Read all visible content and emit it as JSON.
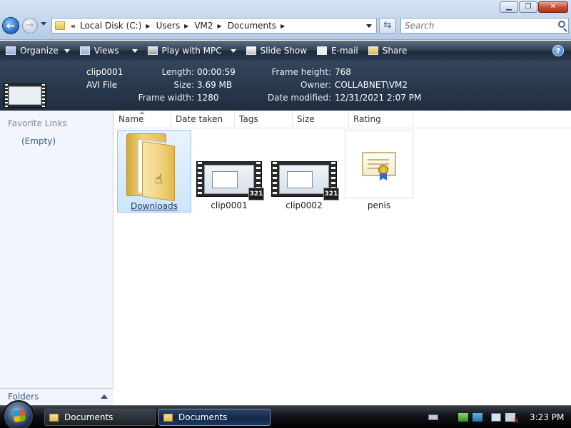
{
  "window": {
    "minimize_glyph": "▁",
    "maximize_glyph": "❐",
    "close_glyph": "✕"
  },
  "address": {
    "crumbs": [
      "Local Disk (C:)",
      "Users",
      "VM2",
      "Documents"
    ],
    "overflow_glyph": "«"
  },
  "search": {
    "placeholder": "Search"
  },
  "toolbar": {
    "organize": "Organize",
    "views": "Views",
    "play": "Play with MPC",
    "slideshow": "Slide Show",
    "email": "E-mail",
    "share": "Share",
    "help": "?"
  },
  "details": {
    "name": "clip0001",
    "type": "AVI File",
    "length_label": "Length:",
    "length": "00:00:59",
    "size_label": "Size:",
    "size": "3.69 MB",
    "fwidth_label": "Frame width:",
    "fwidth": "1280",
    "fheight_label": "Frame height:",
    "fheight": "768",
    "owner_label": "Owner:",
    "owner": "COLLABNET\\VM2",
    "modified_label": "Date modified:",
    "modified": "12/31/2021 2:07 PM"
  },
  "navpane": {
    "favorite_links": "Favorite Links",
    "empty": "(Empty)",
    "folders": "Folders"
  },
  "columns": [
    "Name",
    "Date taken",
    "Tags",
    "Size",
    "Rating"
  ],
  "items": [
    {
      "label": "Downloads",
      "kind": "folder",
      "selected": true
    },
    {
      "label": "clip0001",
      "kind": "video",
      "badge": "321"
    },
    {
      "label": "clip0002",
      "kind": "video",
      "badge": "321"
    },
    {
      "label": "penis",
      "kind": "certificate"
    }
  ],
  "taskbar": {
    "buttons": [
      "Documents",
      "Documents"
    ],
    "clock": "3:23 PM"
  },
  "colors": {
    "accent": "#2c73c9",
    "selection": "#cde5fb",
    "taskbar": "#101318"
  }
}
